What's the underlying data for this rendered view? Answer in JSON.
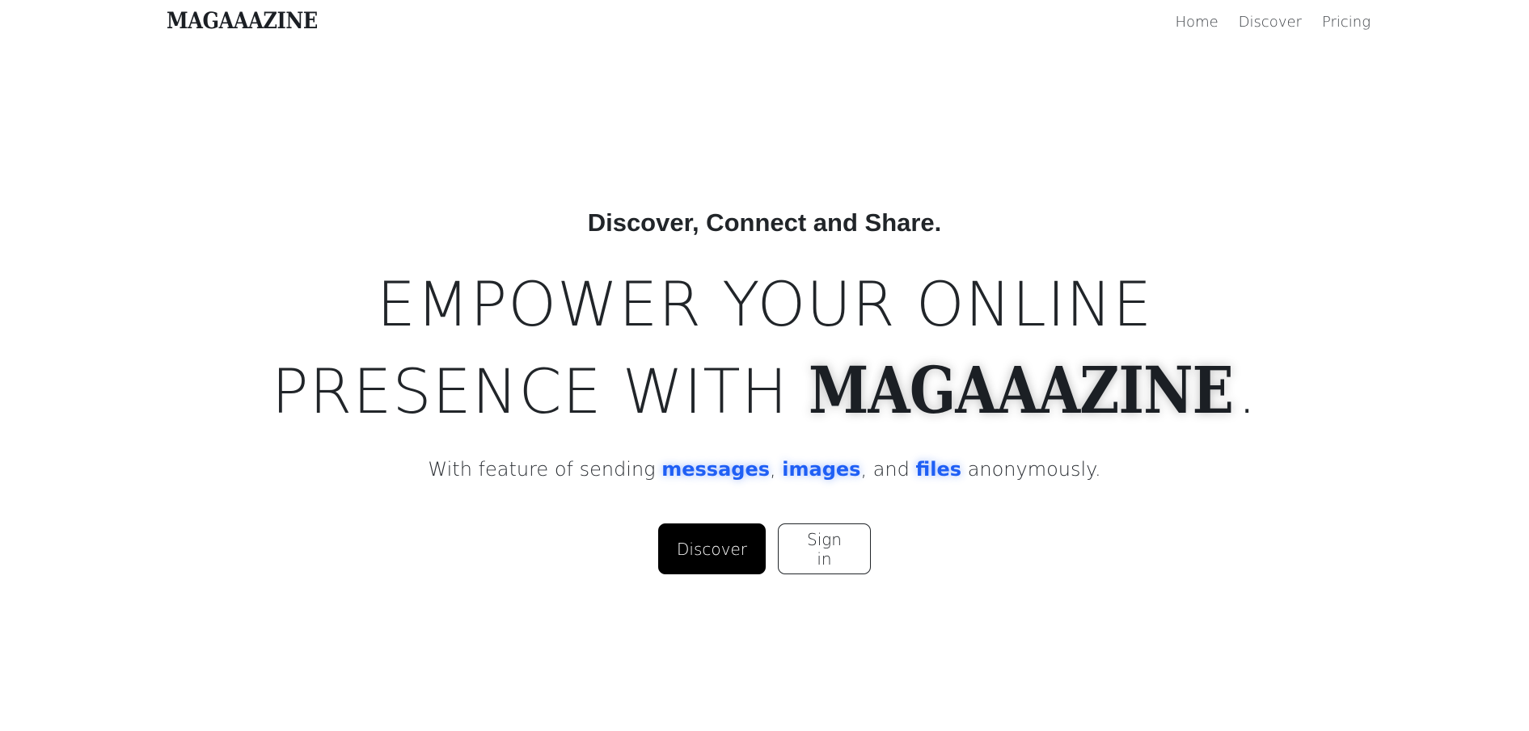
{
  "navbar": {
    "brand": "MAGAAAZINE",
    "links": [
      {
        "label": "Home"
      },
      {
        "label": "Discover"
      },
      {
        "label": "Pricing"
      }
    ]
  },
  "hero": {
    "tagline": "Discover, Connect and Share.",
    "headline_line1": "EMPOWER YOUR ONLINE",
    "headline_line2_prefix": "PRESENCE WITH ",
    "headline_brand": "MAGAAAZINE",
    "headline_suffix": ".",
    "subtitle": {
      "prefix": "With feature of sending ",
      "item1": "messages",
      "sep1": ", ",
      "item2": "images",
      "sep2": ", and ",
      "item3": "files",
      "suffix": " anonymously."
    },
    "buttons": {
      "primary_label": "Discover",
      "secondary_label": "Sign in"
    }
  },
  "colors": {
    "highlight": "#1f5ff5",
    "primary_button_bg": "#000000",
    "text": "#212529"
  }
}
